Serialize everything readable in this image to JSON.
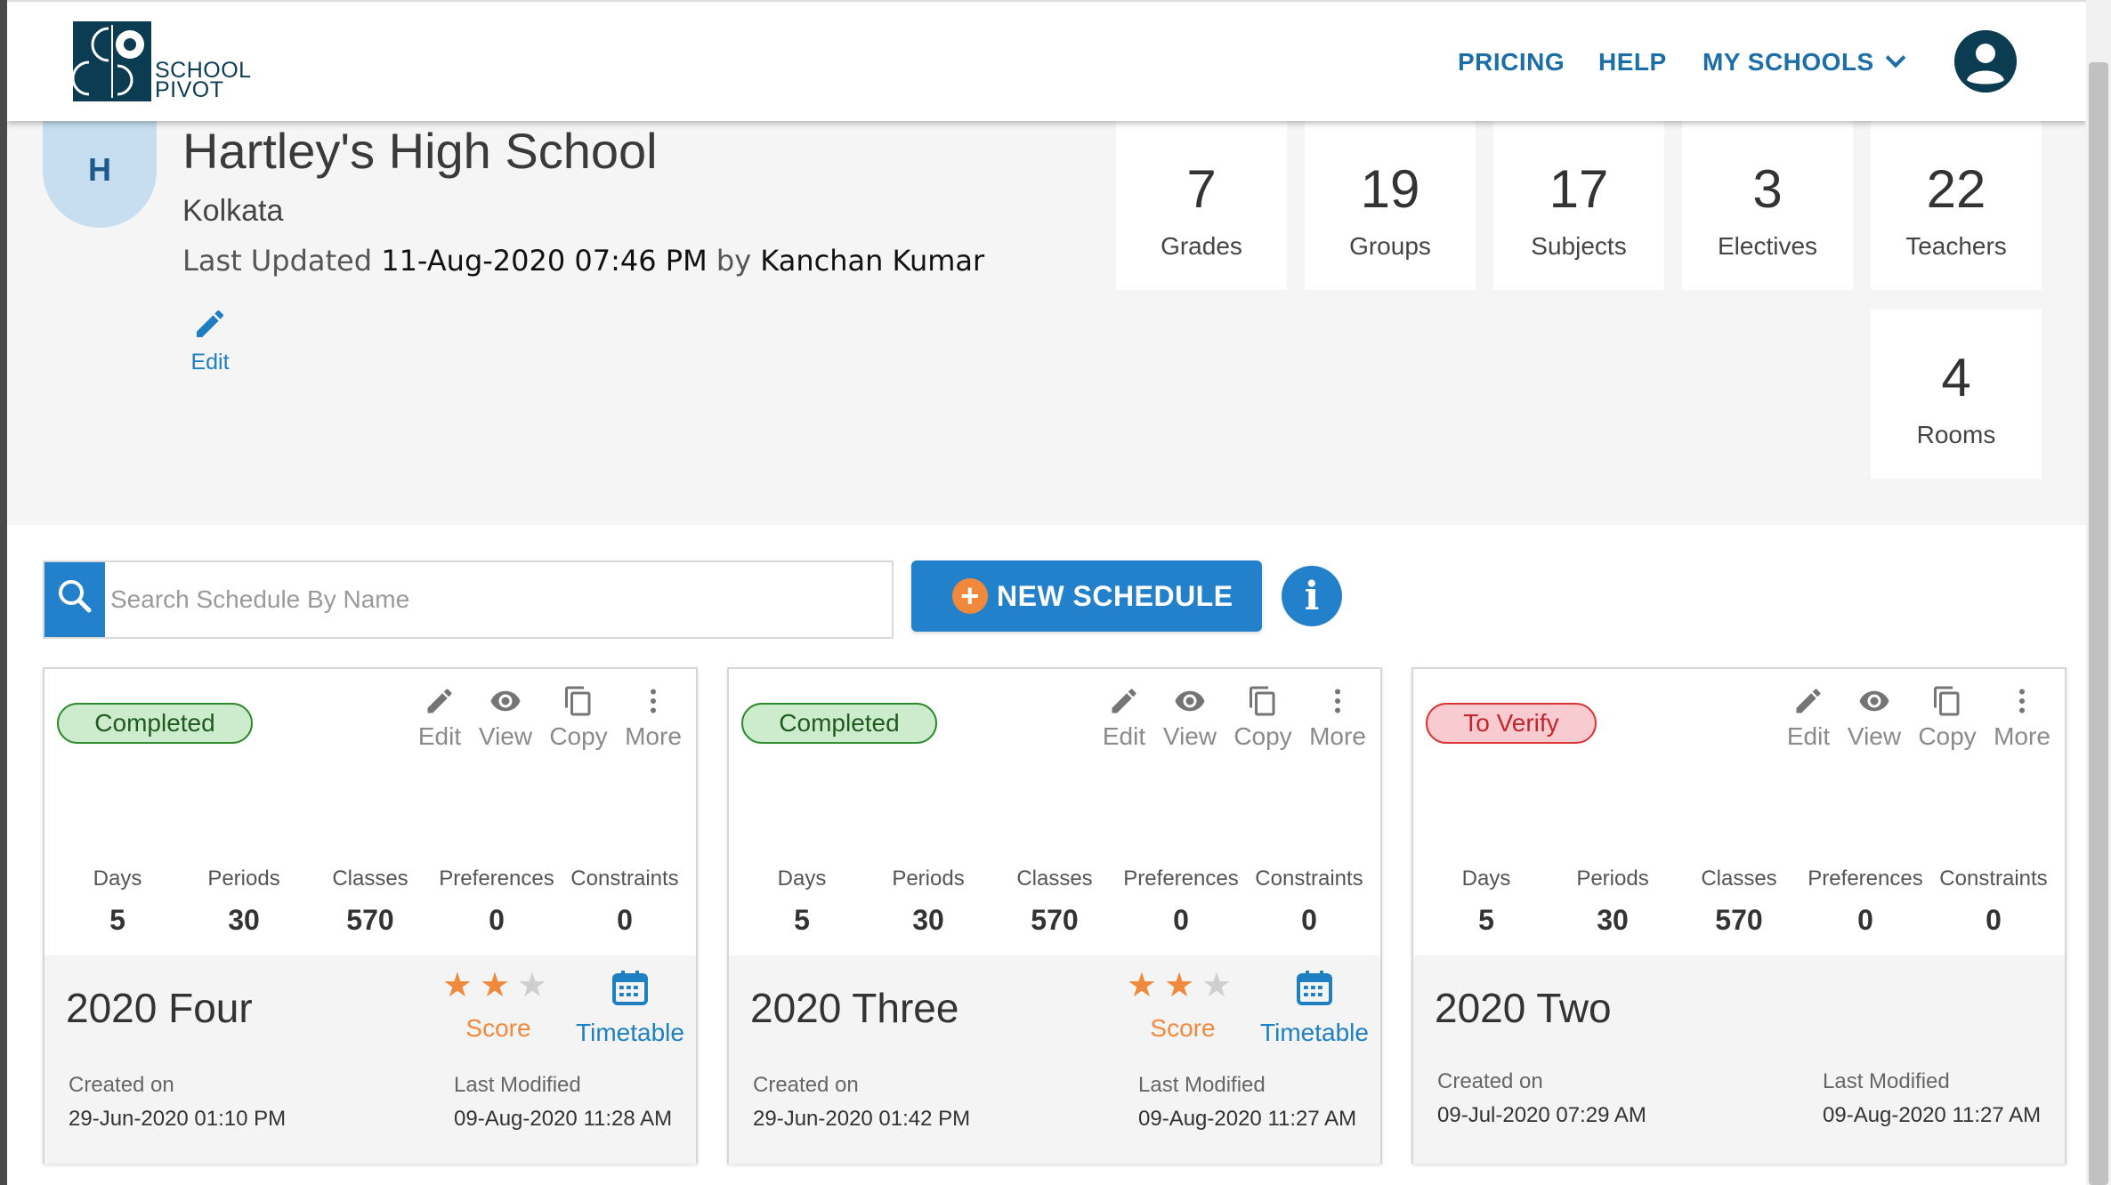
{
  "header": {
    "logo_line1": "SCHOOL",
    "logo_line2": "PIVOT",
    "nav": {
      "pricing": "PRICING",
      "help": "HELP",
      "my_schools": "MY SCHOOLS"
    }
  },
  "school": {
    "initial": "H",
    "name": "Hartley's High School",
    "city": "Kolkata",
    "last_updated_prefix": "Last Updated",
    "last_updated_date": "11-Aug-2020 07:46 PM",
    "last_updated_by": "by",
    "last_updated_user": "Kanchan Kumar",
    "edit_label": "Edit"
  },
  "stats": [
    {
      "value": "7",
      "label": "Grades"
    },
    {
      "value": "19",
      "label": "Groups"
    },
    {
      "value": "17",
      "label": "Subjects"
    },
    {
      "value": "3",
      "label": "Electives"
    },
    {
      "value": "22",
      "label": "Teachers"
    },
    {
      "value": "4",
      "label": "Rooms"
    }
  ],
  "search": {
    "placeholder": "Search Schedule By Name"
  },
  "new_schedule_label": "NEW SCHEDULE",
  "info_label": "i",
  "card_labels": {
    "edit": "Edit",
    "view": "View",
    "copy": "Copy",
    "more": "More",
    "days": "Days",
    "periods": "Periods",
    "classes": "Classes",
    "preferences": "Preferences",
    "constraints": "Constraints",
    "score": "Score",
    "timetable": "Timetable",
    "created_on": "Created on",
    "last_modified": "Last Modified"
  },
  "schedules": [
    {
      "status": "Completed",
      "days": "5",
      "periods": "30",
      "classes": "570",
      "preferences": "0",
      "constraints": "0",
      "name": "2020 Four",
      "stars": 2,
      "created": "29-Jun-2020 01:10 PM",
      "modified": "09-Aug-2020 11:28 AM"
    },
    {
      "status": "Completed",
      "days": "5",
      "periods": "30",
      "classes": "570",
      "preferences": "0",
      "constraints": "0",
      "name": "2020 Three",
      "stars": 2,
      "created": "29-Jun-2020 01:42 PM",
      "modified": "09-Aug-2020 11:27 AM"
    },
    {
      "status": "To Verify",
      "days": "5",
      "periods": "30",
      "classes": "570",
      "preferences": "0",
      "constraints": "0",
      "name": "2020 Two",
      "created": "09-Jul-2020 07:29 AM",
      "modified": "09-Aug-2020 11:27 AM"
    }
  ],
  "colors": {
    "primary": "#2381cb",
    "navy": "#0c3c52",
    "accent": "#f0893c",
    "success": "#2e8a2e",
    "danger": "#d33333"
  }
}
